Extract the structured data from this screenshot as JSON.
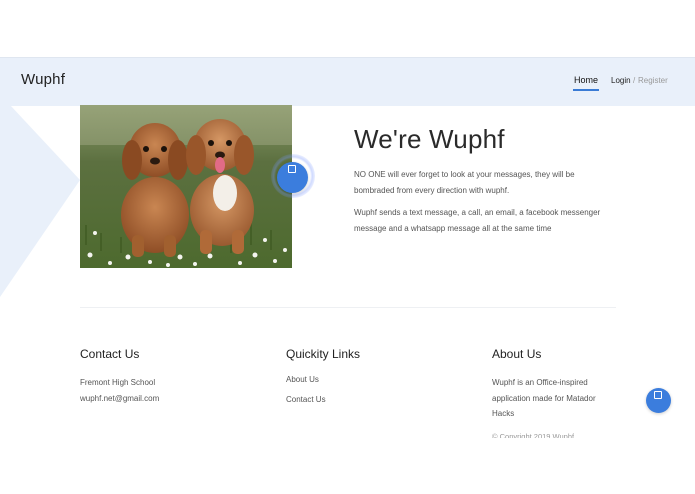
{
  "navbar": {
    "brand": "Wuphf",
    "home_label": "Home",
    "login_label": "Login",
    "separator": "/",
    "register_label": "Register"
  },
  "hero": {
    "title": "We're Wuphf",
    "paragraph1": "NO ONE will ever forget to look at your messages, they will be bombraded from every direction with wuphf.",
    "paragraph2": "Wuphf sends a text message, a call, an email, a facebook messenger message and a whatsapp message all at the same time",
    "image_icon": "puppies-photo"
  },
  "footer": {
    "contact": {
      "heading": "Contact Us",
      "line1": "Fremont High School",
      "line2": "wuphf.net@gmail.com"
    },
    "links": {
      "heading": "Quickity Links",
      "items": [
        "About Us",
        "Contact Us"
      ]
    },
    "about": {
      "heading": "About Us",
      "text": "Wuphf is an Office-inspired application made for Matador Hacks"
    },
    "copyright": "© Copyright 2019 Wuphf"
  },
  "colors": {
    "accent": "#3b7ddd",
    "navbar_bg": "#e9f0fa"
  }
}
